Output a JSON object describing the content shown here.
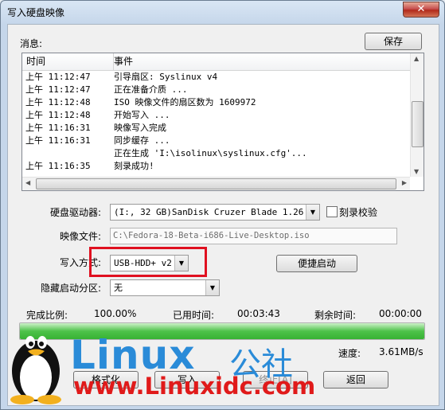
{
  "window": {
    "title": "写入硬盘映像",
    "close_glyph": "✕"
  },
  "log": {
    "label": "消息:",
    "save_button": "保存",
    "columns": [
      "时间",
      "事件"
    ],
    "rows": [
      {
        "time": "上午 11:12:47",
        "event": "引导扇区: Syslinux v4"
      },
      {
        "time": "上午 11:12:47",
        "event": "正在准备介质 ..."
      },
      {
        "time": "上午 11:12:48",
        "event": "ISO 映像文件的扇区数为 1609972"
      },
      {
        "time": "上午 11:12:48",
        "event": "开始写入 ..."
      },
      {
        "time": "上午 11:16:31",
        "event": "映像写入完成"
      },
      {
        "time": "上午 11:16:31",
        "event": "同步缓存 ..."
      },
      {
        "time": "",
        "event": "正在生成 'I:\\isolinux\\syslinux.cfg'..."
      },
      {
        "time": "上午 11:16:35",
        "event": "刻录成功!"
      }
    ]
  },
  "form": {
    "drive_label": "硬盘驱动器:",
    "drive_value": "(I:, 32 GB)SanDisk Cruzer Blade    1.26",
    "verify_label": "刻录校验",
    "image_label": "映像文件:",
    "image_value": "C:\\Fedora-18-Beta-i686-Live-Desktop.iso",
    "method_label": "写入方式:",
    "method_value": "USB-HDD+ v2",
    "quick_boot_button": "便捷启动",
    "hidden_part_label": "隐藏启动分区:",
    "hidden_part_value": "无"
  },
  "status": {
    "complete_label": "完成比例:",
    "complete_value": "100.00%",
    "complete_fraction": 1.0,
    "elapsed_label": "已用时间:",
    "elapsed_value": "00:03:43",
    "remaining_label": "剩余时间:",
    "remaining_value": "00:00:00",
    "speed_label": "速度:",
    "speed_value": "3.61MB/s"
  },
  "buttons": {
    "format": "格式化",
    "write": "写入",
    "abort": "终止[A]",
    "back": "返回"
  },
  "watermark": {
    "brand": "Linux",
    "brand_cn": "公社",
    "url": "www.Linuxidc.com"
  },
  "colors": {
    "highlight_box": "#e01020",
    "progress": "#37b233",
    "watermark_blue": "#2a8bd8",
    "watermark_red": "#e01a1a"
  },
  "icons": {
    "title_icon": "disk-write-icon",
    "close_icon": "close-icon",
    "mascot": "tux-penguin-icon"
  }
}
